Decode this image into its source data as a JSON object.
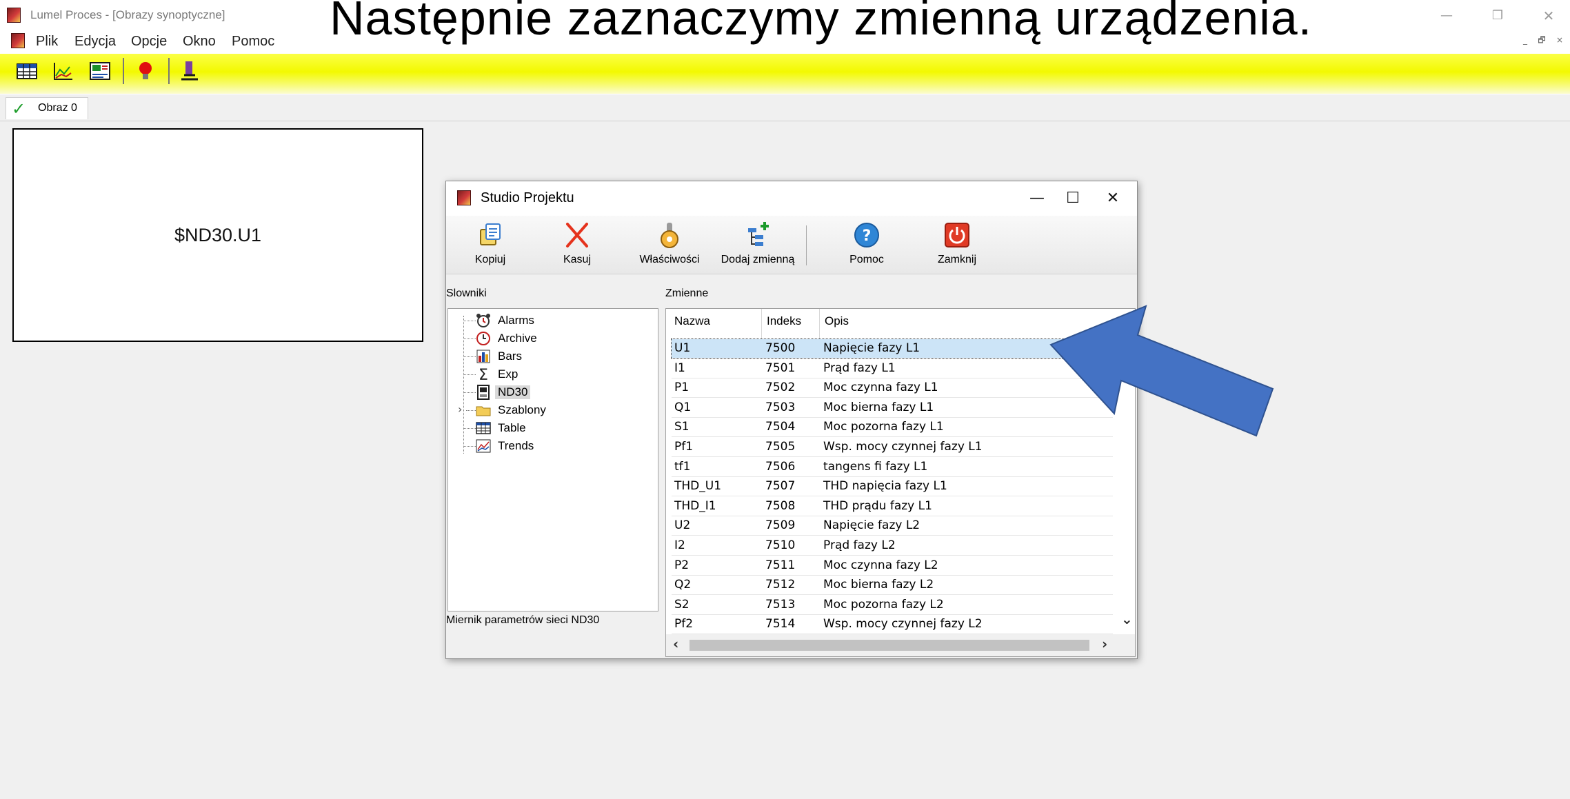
{
  "window": {
    "title": "Lumel Proces - [Obrazy synoptyczne]",
    "caption": "Następnie zaznaczymy zmienną urządzenia.",
    "controls": {
      "minimize": "—",
      "restore": "❐",
      "close": "✕"
    },
    "mdi_controls": {
      "minimize": "_",
      "restore": "🗗",
      "close": "×"
    }
  },
  "menu": [
    "Plik",
    "Edycja",
    "Opcje",
    "Okno",
    "Pomoc"
  ],
  "toolbar": {
    "icons": [
      "table-icon",
      "chart-icon",
      "trend-icon",
      "alarm-bulb-icon",
      "tool-icon"
    ]
  },
  "tabs": [
    {
      "label": "Obraz 0"
    }
  ],
  "canvas": {
    "box_value": "$ND30.U1"
  },
  "dialog": {
    "title": "Studio Projektu",
    "controls": {
      "minimize": "—",
      "maximize": "☐",
      "close": "✕"
    },
    "toolbar": [
      {
        "label": "Kopiuj",
        "icon": "copy-icon"
      },
      {
        "label": "Kasuj",
        "icon": "delete-icon"
      },
      {
        "label": "Właściwości",
        "icon": "properties-icon"
      },
      {
        "label": "Dodaj zmienną",
        "icon": "add-variable-icon"
      },
      {
        "label": "Pomoc",
        "icon": "help-icon"
      },
      {
        "label": "Zamknij",
        "icon": "power-icon"
      }
    ],
    "left_panel": {
      "header": "Slowniki",
      "tree": [
        {
          "label": "Alarms",
          "icon": "alarm-clock-icon"
        },
        {
          "label": "Archive",
          "icon": "archive-clock-icon"
        },
        {
          "label": "Bars",
          "icon": "bars-icon"
        },
        {
          "label": "Exp",
          "icon": "sigma-icon"
        },
        {
          "label": "ND30",
          "icon": "meter-icon",
          "selected": true
        },
        {
          "label": "Szablony",
          "icon": "folder-icon",
          "expandable": true
        },
        {
          "label": "Table",
          "icon": "table-icon"
        },
        {
          "label": "Trends",
          "icon": "trends-icon"
        }
      ],
      "description": "Miernik parametrów sieci ND30"
    },
    "right_panel": {
      "header": "Zmienne",
      "columns": [
        "Nazwa",
        "Indeks",
        "Opis"
      ],
      "rows": [
        [
          "U1",
          "7500",
          "Napięcie fazy L1"
        ],
        [
          "I1",
          "7501",
          "Prąd fazy L1"
        ],
        [
          "P1",
          "7502",
          "Moc czynna fazy L1"
        ],
        [
          "Q1",
          "7503",
          "Moc bierna fazy L1"
        ],
        [
          "S1",
          "7504",
          "Moc pozorna fazy L1"
        ],
        [
          "Pf1",
          "7505",
          "Wsp. mocy czynnej fazy L1"
        ],
        [
          "tf1",
          "7506",
          "tangens fi fazy L1"
        ],
        [
          "THD_U1",
          "7507",
          "THD napięcia fazy L1"
        ],
        [
          "THD_I1",
          "7508",
          "THD prądu fazy L1"
        ],
        [
          "U2",
          "7509",
          "Napięcie fazy L2"
        ],
        [
          "I2",
          "7510",
          "Prąd fazy L2"
        ],
        [
          "P2",
          "7511",
          "Moc czynna fazy L2"
        ],
        [
          "Q2",
          "7512",
          "Moc bierna fazy L2"
        ],
        [
          "S2",
          "7513",
          "Moc pozorna fazy L2"
        ],
        [
          "Pf2",
          "7514",
          "Wsp. mocy czynnej fazy L2"
        ]
      ],
      "selected_row": 0
    }
  },
  "annotation": {
    "arrow_color": "#4472c4"
  }
}
